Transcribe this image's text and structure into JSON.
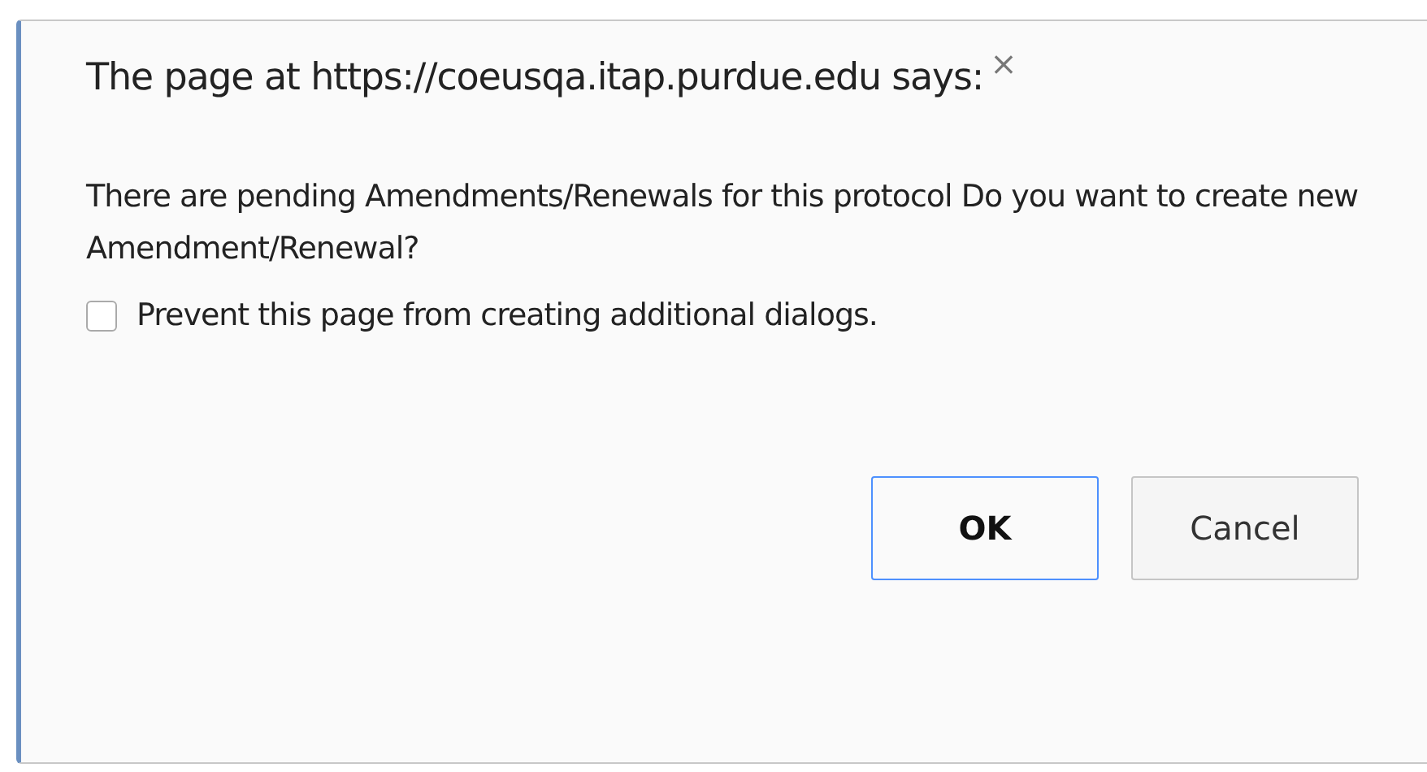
{
  "dialog": {
    "title": "The page at https://coeusqa.itap.purdue.edu says:",
    "close": "×",
    "message": "There are pending Amendments/Renewals for this protocol  Do you want to create new Amendment/Renewal?",
    "checkbox": {
      "label": "Prevent this page from creating additional dialogs.",
      "checked": false
    },
    "buttons": [
      {
        "label": "OK",
        "default": true
      },
      {
        "label": "Cancel",
        "default": false
      }
    ]
  }
}
